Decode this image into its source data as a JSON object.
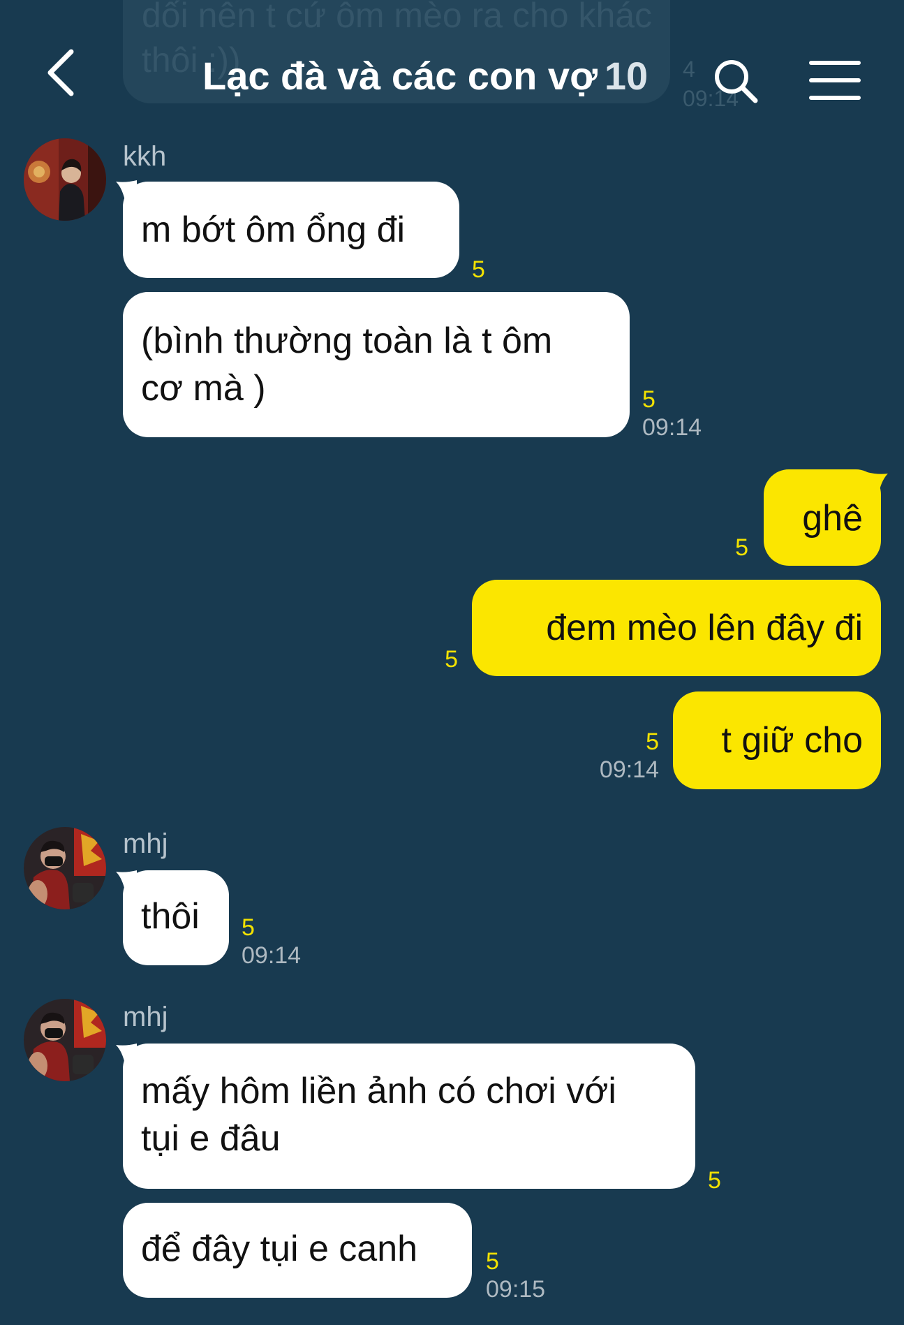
{
  "header": {
    "title": "Lạc đà và các con vợ",
    "member_count": "10"
  },
  "previous_message": {
    "text": "dối nên t cứ ôm mèo ra cho khác thôi :))",
    "unread": "4",
    "time": "09:14"
  },
  "messages": [
    {
      "sender": "kkh",
      "text_lines": [
        "m bớt ôm ổng đi"
      ],
      "unread": "5",
      "time": ""
    },
    {
      "sender": "",
      "text_lines": [
        "(bình thường toàn là t ôm",
        "cơ mà )"
      ],
      "unread": "5",
      "time": "09:14"
    },
    {
      "sender": "me",
      "text_lines": [
        "ghê"
      ],
      "unread": "5",
      "time": ""
    },
    {
      "sender": "me",
      "text_lines": [
        "đem mèo lên đây đi"
      ],
      "unread": "5",
      "time": ""
    },
    {
      "sender": "me",
      "text_lines": [
        "t giữ cho"
      ],
      "unread": "5",
      "time": "09:14"
    },
    {
      "sender": "mhj",
      "text_lines": [
        "thôi"
      ],
      "unread": "5",
      "time": "09:14"
    },
    {
      "sender": "mhj",
      "text_lines": [
        "mấy hôm liền ảnh có chơi với",
        "tụi e đâu"
      ],
      "unread": "5",
      "time": ""
    },
    {
      "sender": "",
      "text_lines": [
        "để đây tụi e canh"
      ],
      "unread": "5",
      "time": "09:15"
    }
  ],
  "colors": {
    "background": "#183a50",
    "incoming_bubble": "#ffffff",
    "outgoing_bubble": "#fbe600",
    "unread_count": "#f3e200",
    "timestamp": "#aeb9c1"
  },
  "icons": {
    "back": "chevron-left-icon",
    "search": "search-icon",
    "menu": "hamburger-menu-icon"
  }
}
